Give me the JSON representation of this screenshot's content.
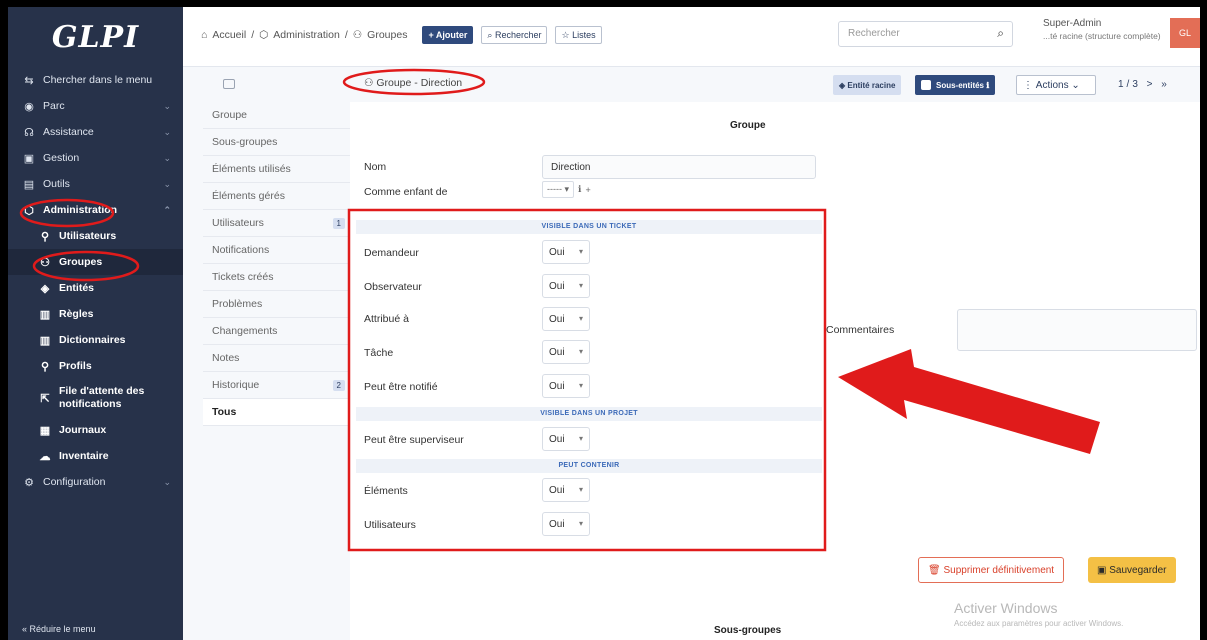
{
  "app": {
    "logo": "GLPI"
  },
  "sidebar": {
    "search": "Chercher dans le menu",
    "items": [
      {
        "label": "Parc"
      },
      {
        "label": "Assistance"
      },
      {
        "label": "Gestion"
      },
      {
        "label": "Outils"
      },
      {
        "label": "Administration"
      }
    ],
    "sub": [
      {
        "label": "Utilisateurs"
      },
      {
        "label": "Groupes"
      },
      {
        "label": "Entités"
      },
      {
        "label": "Règles"
      },
      {
        "label": "Dictionnaires"
      },
      {
        "label": "Profils"
      },
      {
        "label": "File d'attente des notifications"
      },
      {
        "label": "Journaux"
      },
      {
        "label": "Inventaire"
      }
    ],
    "config": "Configuration",
    "reduce": "Réduire le menu"
  },
  "header": {
    "crumbs": [
      "Accueil",
      "Administration",
      "Groupes"
    ],
    "add": "+ Ajouter",
    "search_btn": "Rechercher",
    "lists_btn": "Listes",
    "search_placeholder": "Rechercher",
    "user": "Super-Admin",
    "entity": "...té racine (structure complète)",
    "avatar": "GL"
  },
  "tabs": [
    {
      "label": "Groupe",
      "count": ""
    },
    {
      "label": "Sous-groupes",
      "count": ""
    },
    {
      "label": "Éléments utilisés",
      "count": ""
    },
    {
      "label": "Éléments gérés",
      "count": ""
    },
    {
      "label": "Utilisateurs",
      "count": "1"
    },
    {
      "label": "Notifications",
      "count": ""
    },
    {
      "label": "Tickets créés",
      "count": ""
    },
    {
      "label": "Problèmes",
      "count": ""
    },
    {
      "label": "Changements",
      "count": ""
    },
    {
      "label": "Notes",
      "count": ""
    },
    {
      "label": "Historique",
      "count": "2"
    },
    {
      "label": "Tous",
      "count": ""
    }
  ],
  "toolbar": {
    "title": "Groupe - Direction",
    "entity": "Entité racine",
    "subentities": "Sous-entités",
    "actions": "Actions",
    "pager": "1/3 > »"
  },
  "form": {
    "section": "Groupe",
    "name_label": "Nom",
    "name_value": "Direction",
    "parent_label": "Comme enfant de",
    "parent_value": "-----",
    "band_ticket": "VISIBLE DANS UN TICKET",
    "band_project": "VISIBLE DANS UN PROJET",
    "band_contain": "PEUT CONTENIR",
    "rows": [
      {
        "label": "Demandeur",
        "value": "Oui"
      },
      {
        "label": "Observateur",
        "value": "Oui"
      },
      {
        "label": "Attribué à",
        "value": "Oui"
      },
      {
        "label": "Tâche",
        "value": "Oui"
      },
      {
        "label": "Peut être notifié",
        "value": "Oui"
      },
      {
        "label": "Peut être superviseur",
        "value": "Oui"
      },
      {
        "label": "Éléments",
        "value": "Oui"
      },
      {
        "label": "Utilisateurs",
        "value": "Oui"
      }
    ],
    "comments_label": "Commentaires",
    "delete": "Supprimer définitivement",
    "save": "Sauvegarder",
    "subgroups": "Sous-groupes"
  },
  "watermark": {
    "line1": "Activer Windows",
    "line2": "Accédez aux paramètres pour activer Windows."
  },
  "colors": {
    "sidebar": "#27324a",
    "primary": "#2f4a7d",
    "annotation": "#e01b1b",
    "save": "#f4c045"
  }
}
